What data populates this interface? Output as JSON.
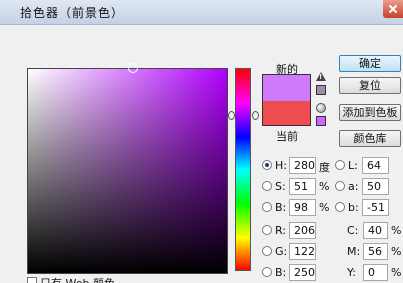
{
  "window": {
    "title": "拾色器（前景色）"
  },
  "colors": {
    "new": "#ce7afa",
    "current": "#ee4c4f",
    "gamut_warning": "#a08cb0",
    "web_safe": "#cc66ff"
  },
  "preview": {
    "new_label": "新的",
    "current_label": "当前"
  },
  "buttons": {
    "ok": "确定",
    "reset": "复位",
    "add_to_swatches": "添加到色板",
    "color_libraries": "颜色库"
  },
  "hsb": {
    "h": {
      "label": "H:",
      "value": "280",
      "unit": "度"
    },
    "s": {
      "label": "S:",
      "value": "51",
      "unit": "%"
    },
    "b": {
      "label": "B:",
      "value": "98",
      "unit": "%"
    }
  },
  "lab": {
    "l": {
      "label": "L:",
      "value": "64"
    },
    "a": {
      "label": "a:",
      "value": "50"
    },
    "b": {
      "label": "b:",
      "value": "-51"
    }
  },
  "rgb": {
    "r": {
      "label": "R:",
      "value": "206"
    },
    "g": {
      "label": "G:",
      "value": "122"
    },
    "b": {
      "label": "B:",
      "value": "250"
    }
  },
  "cmyk": {
    "c": {
      "label": "C:",
      "value": "40",
      "unit": "%"
    },
    "m": {
      "label": "M:",
      "value": "56",
      "unit": "%"
    },
    "y": {
      "label": "Y:",
      "value": "0",
      "unit": "%"
    }
  },
  "web_only": {
    "label": "只有 Web 颜色"
  }
}
